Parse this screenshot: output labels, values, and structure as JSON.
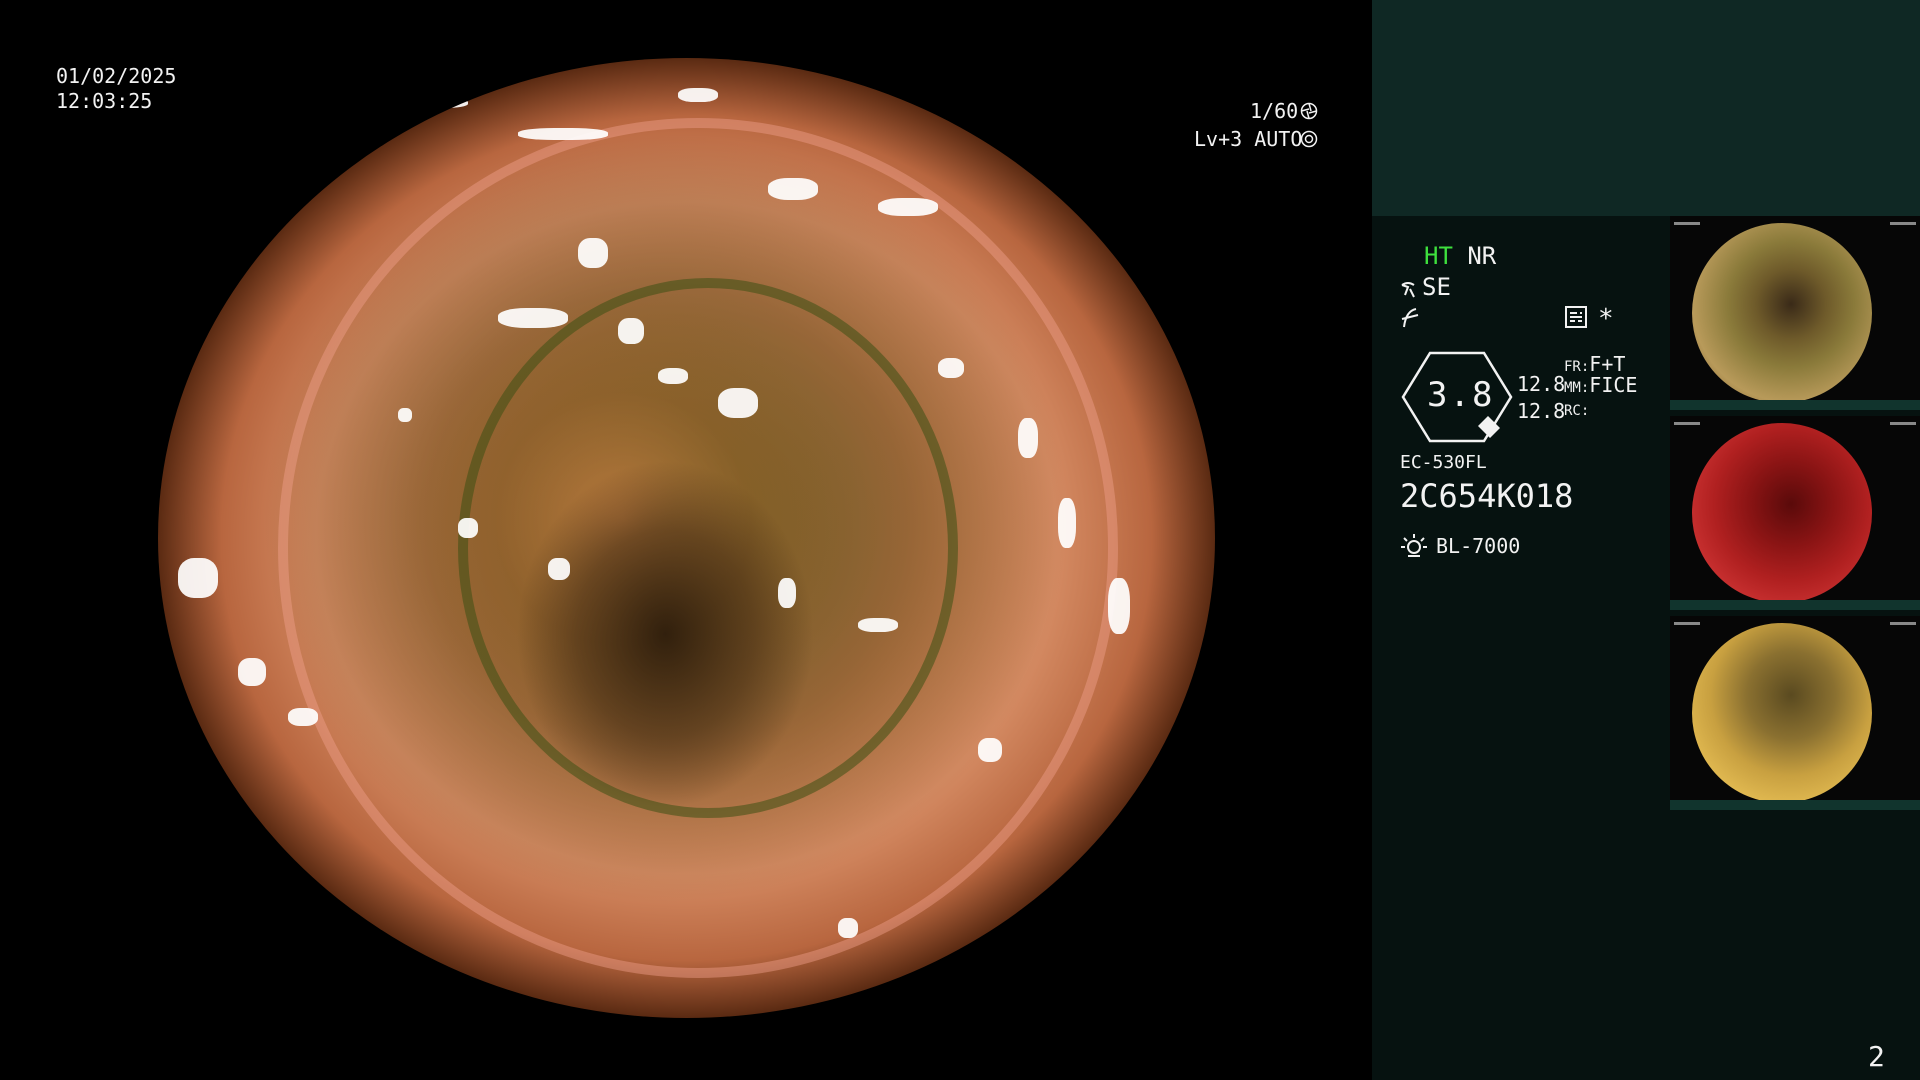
{
  "overlay": {
    "date": "01/02/2025",
    "time": "12:03:25",
    "shutter": "1/60",
    "level": "Lv+3",
    "iris_mode": "AUTO"
  },
  "panel": {
    "ht": "HT",
    "nr": "NR",
    "se": "SE",
    "zoom": "3.8",
    "val1": "12.8",
    "val2": "12.8",
    "fr_label": "FR:",
    "fr_value": "F+T",
    "mm_label": "MM:",
    "mm_value": "FICE",
    "rc_label": "RC:",
    "asterisk": "*",
    "scope_model": "EC-530FL",
    "serial": "2C654K018",
    "light_source": "BL-7000"
  },
  "thumbnails": [
    {
      "tone": "yellow-green"
    },
    {
      "tone": "red"
    },
    {
      "tone": "yellow"
    }
  ],
  "page_number": "2",
  "colors": {
    "ht_green": "#3ee03e",
    "panel_bg": "#061210",
    "panel_header": "#0f2824"
  },
  "icons": [
    "shutter-icon",
    "iris-icon",
    "enhance-icon",
    "filter-icon",
    "menu-icon",
    "zoom-hexagon-icon",
    "lamp-icon"
  ]
}
